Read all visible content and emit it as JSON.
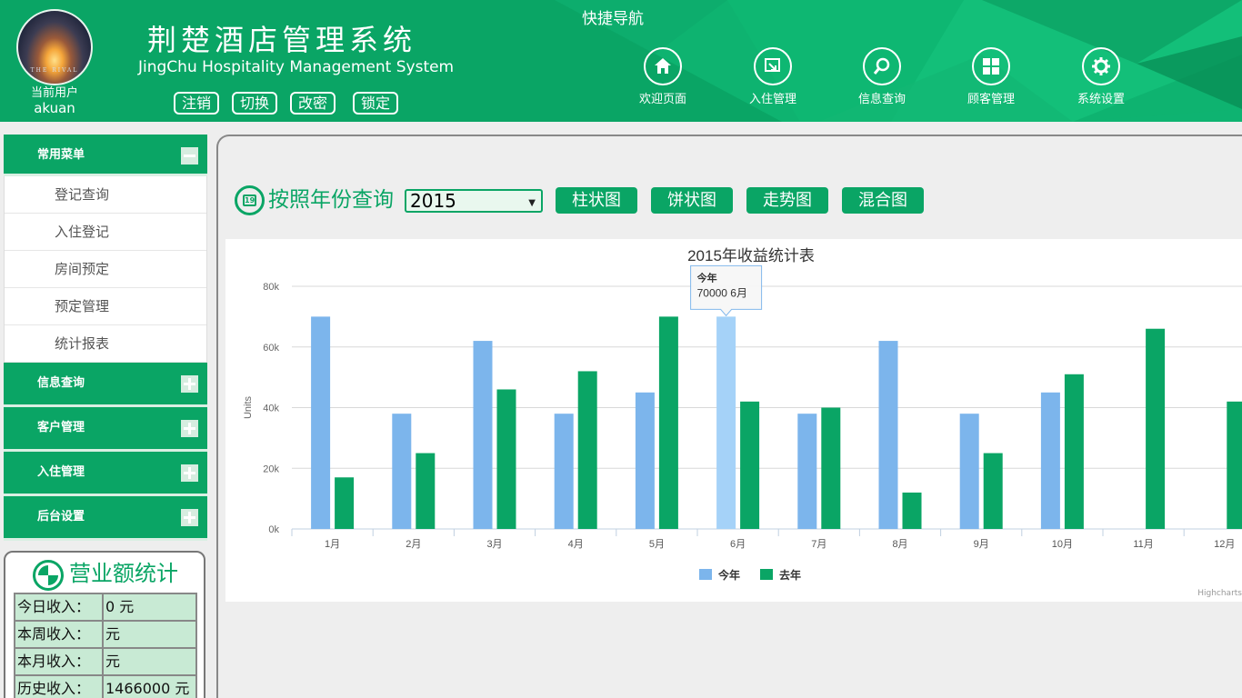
{
  "header": {
    "user_label": "当前用户",
    "user_name": "akuan",
    "avatar_caption": "THE RIVAL",
    "title": "荆楚酒店管理系统",
    "subtitle": "JingChu Hospitality Management System",
    "buttons": [
      "注销",
      "切换",
      "改密",
      "锁定"
    ],
    "quicknav_title": "快捷导航",
    "nav": [
      {
        "label": "欢迎页面",
        "icon": "home-icon"
      },
      {
        "label": "入住管理",
        "icon": "checkin-icon"
      },
      {
        "label": "信息查询",
        "icon": "search-icon"
      },
      {
        "label": "顾客管理",
        "icon": "grid-icon"
      },
      {
        "label": "系统设置",
        "icon": "gear-icon"
      }
    ]
  },
  "sidebar": {
    "common_menu": {
      "label": "常用菜单",
      "items": [
        "登记查询",
        "入住登记",
        "房间预定",
        "预定管理",
        "统计报表"
      ]
    },
    "sections": [
      "信息查询",
      "客户管理",
      "入住管理",
      "后台设置"
    ]
  },
  "revenue": {
    "title": "营业额统计",
    "rows": [
      {
        "key": "今日收入：",
        "value": "0 元"
      },
      {
        "key": "本周收入：",
        "value": "元"
      },
      {
        "key": "本月收入：",
        "value": "元"
      },
      {
        "key": "历史收入：",
        "value": "1466000 元"
      }
    ]
  },
  "query": {
    "label": "按照年份查询",
    "year": "2015",
    "calendar_icon_text": "19",
    "buttons": [
      "柱状图",
      "饼状图",
      "走势图",
      "混合图"
    ]
  },
  "colors": {
    "brand": "#0aa565",
    "this_year": "#7cb5ec",
    "last_year": "#0aa565",
    "hover": "#a5d2f8"
  },
  "chart_data": {
    "type": "bar",
    "title": "2015年收益统计表",
    "ylabel": "Units",
    "ylim": [
      0,
      80000
    ],
    "yticks": [
      "0k",
      "20k",
      "40k",
      "60k",
      "80k"
    ],
    "categories": [
      "1月",
      "2月",
      "3月",
      "4月",
      "5月",
      "6月",
      "7月",
      "8月",
      "9月",
      "10月",
      "11月",
      "12月"
    ],
    "series": [
      {
        "name": "今年",
        "values": [
          70000,
          38000,
          62000,
          38000,
          45000,
          70000,
          38000,
          62000,
          38000,
          45000,
          0,
          0
        ]
      },
      {
        "name": "去年",
        "values": [
          17000,
          25000,
          46000,
          52000,
          70000,
          42000,
          40000,
          12000,
          25000,
          51000,
          66000,
          42000
        ]
      }
    ],
    "tooltip": {
      "series": "今年",
      "text": "70000 6月",
      "category_index": 5
    },
    "legend": "bottom-center",
    "credit": "Highcharts"
  }
}
